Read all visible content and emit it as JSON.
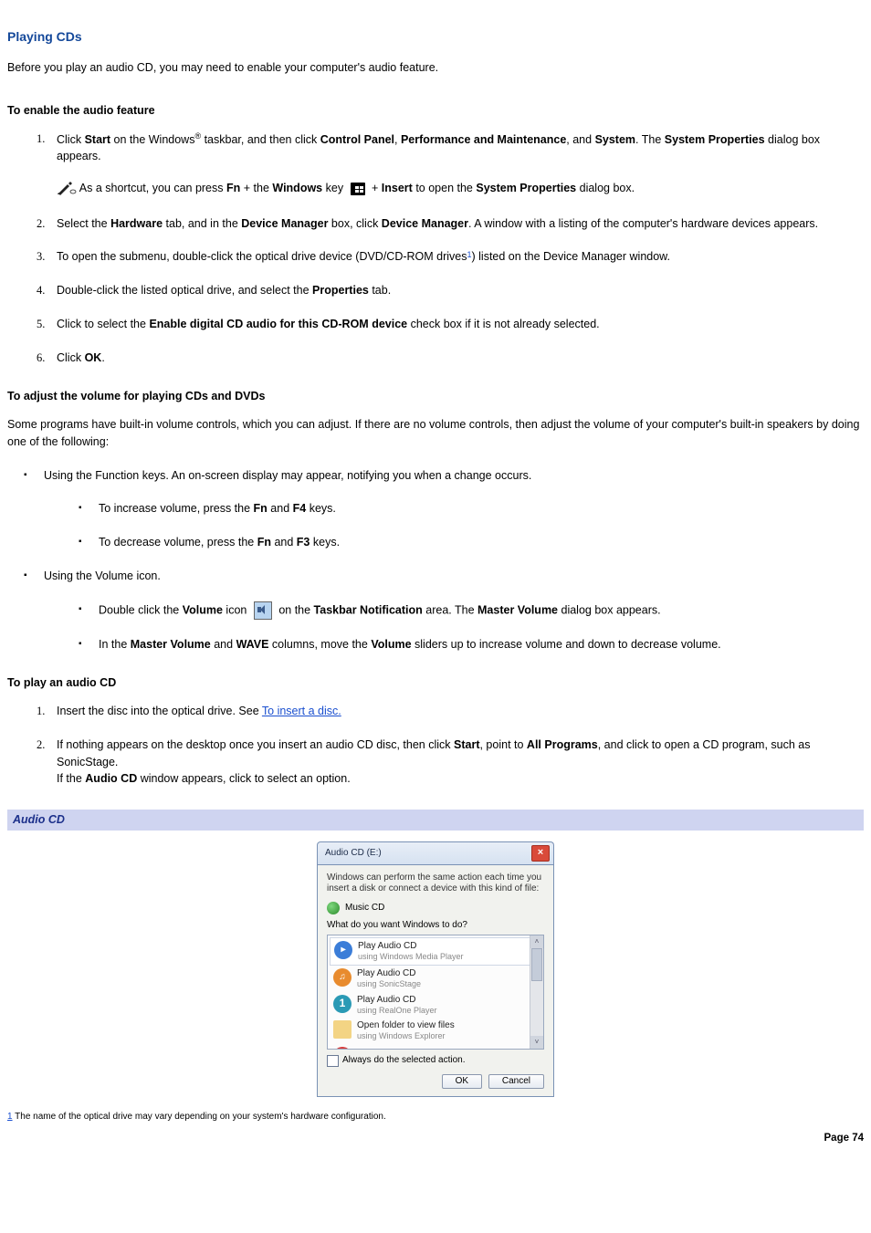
{
  "title": "Playing CDs",
  "intro": "Before you play an audio CD, you may need to enable your computer's audio feature.",
  "sec1_head": "To enable the audio feature",
  "step1_parts": [
    "Click ",
    "Start",
    " on the Windows",
    "®",
    " taskbar, and then click ",
    "Control Panel",
    ", ",
    "Performance and Maintenance",
    ", and ",
    "System",
    ". The ",
    "System Properties",
    " dialog box appears."
  ],
  "note_parts": [
    "As a shortcut, you can press ",
    "Fn",
    " + the ",
    "Windows",
    " key ",
    " + ",
    "Insert",
    " to open the ",
    "System Properties",
    " dialog box."
  ],
  "step2_parts": [
    "Select the ",
    "Hardware",
    " tab, and in the ",
    "Device Manager",
    " box, click ",
    "Device Manager",
    ". A window with a listing of the computer's hardware devices appears."
  ],
  "step3_parts": [
    "To open the submenu, double-click the optical drive device (DVD/CD-ROM drives",
    "1",
    ") listed on the Device Manager window."
  ],
  "step4_parts": [
    "Double-click the listed optical drive, and select the ",
    "Properties",
    " tab."
  ],
  "step5_parts": [
    "Click to select the ",
    "Enable digital CD audio for this CD-ROM device",
    " check box if it is not already selected."
  ],
  "step6_parts": [
    "Click ",
    "OK",
    "."
  ],
  "sec2_head": "To adjust the volume for playing CDs and DVDs",
  "sec2_intro": "Some programs have built-in volume controls, which you can adjust. If there are no volume controls, then adjust the volume of your computer's built-in speakers by doing one of the following:",
  "b1": "Using the Function keys. An on-screen display may appear, notifying you when a change occurs.",
  "b1a_parts": [
    "To increase volume, press the ",
    "Fn",
    " and ",
    "F4",
    " keys."
  ],
  "b1b_parts": [
    "To decrease volume, press the ",
    "Fn",
    " and ",
    "F3",
    " keys."
  ],
  "b2": "Using the Volume icon.",
  "b2a_parts": [
    "Double click the ",
    "Volume",
    " icon ",
    " on the ",
    "Taskbar Notification",
    " area. The ",
    "Master Volume",
    " dialog box appears."
  ],
  "b2b_parts": [
    "In the ",
    "Master Volume",
    " and ",
    "WAVE",
    " columns, move the ",
    "Volume",
    " sliders up to increase volume and down to decrease volume."
  ],
  "sec3_head": "To play an audio CD",
  "p_step1_pre": "Insert the disc into the optical drive. See ",
  "p_step1_link": "To insert a disc.",
  "p_step2_parts": [
    "If nothing appears on the desktop once you insert an audio CD disc, then click ",
    "Start",
    ", point to ",
    "All Programs",
    ", and click to open a CD program, such as SonicStage."
  ],
  "p_step2_line2_parts": [
    "If the ",
    "Audio CD",
    " window appears, click to select an option."
  ],
  "caption": "Audio CD",
  "dlg": {
    "title": "Audio CD (E:)",
    "explain": "Windows can perform the same action each time you insert a disk or connect a device with this kind of file:",
    "music": "Music CD",
    "prompt": "What do you want Windows to do?",
    "opts": [
      {
        "l1": "Play Audio CD",
        "l2": "using Windows Media Player"
      },
      {
        "l1": "Play Audio CD",
        "l2": "using SonicStage"
      },
      {
        "l1": "Play Audio CD",
        "l2": "using RealOne Player"
      },
      {
        "l1": "Open folder to view files",
        "l2": "using Windows Explorer"
      }
    ],
    "always": "Always do the selected action.",
    "ok": "OK",
    "cancel": "Cancel"
  },
  "footnote_num": "1",
  "footnote_text": " The name of the optical drive may vary depending on your system's hardware configuration.",
  "page": "Page 74"
}
